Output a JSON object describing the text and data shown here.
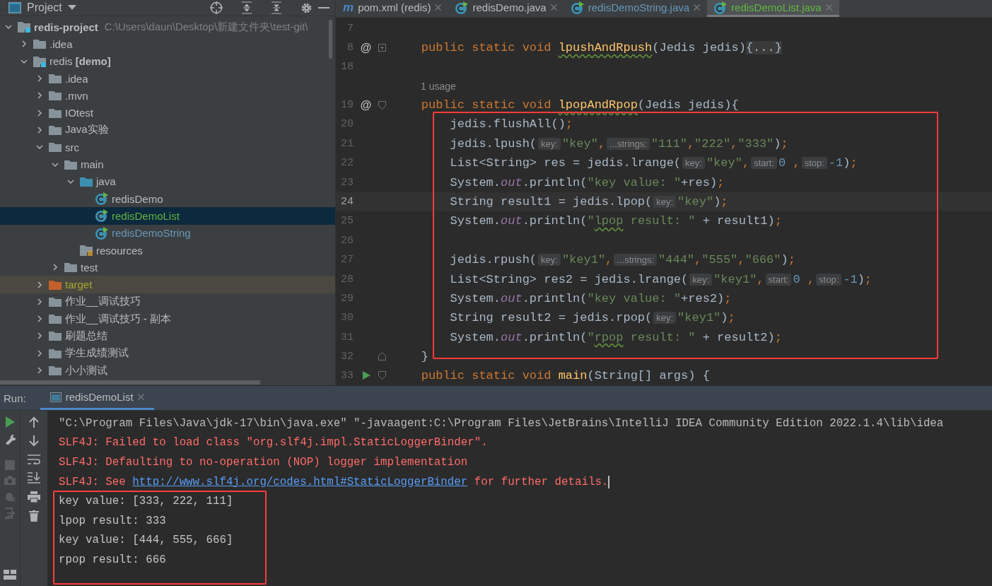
{
  "project_panel": {
    "title": "Project",
    "tree": [
      {
        "label": "redis-project",
        "kind": "module",
        "expanded": true,
        "selected": false,
        "path": "C:\\Users\\daun\\Desktop\\新建文件夹\\test-git\\",
        "children": [
          {
            "label": ".idea",
            "kind": "folder",
            "expanded": false,
            "selected": false
          },
          {
            "label": "redis **[demo]**",
            "kind": "module",
            "expanded": true,
            "selected": false,
            "children": [
              {
                "label": ".idea",
                "kind": "folder",
                "expanded": false,
                "selected": false
              },
              {
                "label": ".mvn",
                "kind": "folder",
                "expanded": false,
                "selected": false
              },
              {
                "label": "IOtest",
                "kind": "folder",
                "expanded": false,
                "selected": false
              },
              {
                "label": "Java实验",
                "kind": "folder",
                "expanded": false,
                "selected": false
              },
              {
                "label": "src",
                "kind": "folder",
                "expanded": true,
                "selected": false,
                "children": [
                  {
                    "label": "main",
                    "kind": "folder",
                    "expanded": true,
                    "selected": false,
                    "children": [
                      {
                        "label": "java",
                        "kind": "source-folder",
                        "expanded": true,
                        "selected": false,
                        "children": [
                          {
                            "label": "redisDemo",
                            "kind": "class",
                            "selected": false,
                            "color": "#bbbbbb"
                          },
                          {
                            "label": "redisDemoList",
                            "kind": "class",
                            "selected": true,
                            "color": "#62b543"
                          },
                          {
                            "label": "redisDemoString",
                            "kind": "class",
                            "selected": false,
                            "color": "#6897bb"
                          }
                        ]
                      },
                      {
                        "label": "resources",
                        "kind": "resources",
                        "selected": false
                      }
                    ]
                  },
                  {
                    "label": "test",
                    "kind": "folder",
                    "expanded": false,
                    "selected": false
                  }
                ]
              },
              {
                "label": "target",
                "kind": "excluded",
                "expanded": false,
                "selected": false
              },
              {
                "label": "作业__调试技巧",
                "kind": "folder",
                "expanded": false,
                "selected": false
              },
              {
                "label": "作业__调试技巧 - 副本",
                "kind": "folder",
                "expanded": false,
                "selected": false
              },
              {
                "label": "刷题总结",
                "kind": "folder",
                "expanded": false,
                "selected": false
              },
              {
                "label": "学生成绩测试",
                "kind": "folder",
                "expanded": false,
                "selected": false
              },
              {
                "label": "小小测试",
                "kind": "folder",
                "expanded": false,
                "selected": false
              }
            ]
          }
        ]
      }
    ]
  },
  "editor": {
    "tabs": [
      {
        "label": "pom.xml (redis)",
        "kind": "maven",
        "glyph": "m",
        "selected": false,
        "color": "#bbbbbb"
      },
      {
        "label": "redisDemo.java",
        "kind": "class",
        "selected": false,
        "color": "#bbbbbb"
      },
      {
        "label": "redisDemoString.java",
        "kind": "class",
        "selected": false,
        "color": "#6897bb"
      },
      {
        "label": "redisDemoList.java",
        "kind": "class",
        "selected": true,
        "color": "#62b543"
      }
    ],
    "lines": [
      {
        "number": "7",
        "current": false
      },
      {
        "number": "8",
        "gutter": {
          "kind": "override",
          "text": "@"
        },
        "fold": {
          "kind": "expand"
        },
        "current": false,
        "tokens": [
          {
            "kind": "kw",
            "text": "    public static void "
          },
          {
            "kind": "method",
            "text": "lpushAndRpush"
          },
          {
            "kind": "plain",
            "text": "(Jedis jedis)"
          },
          {
            "kind": "folded",
            "text": "{...}"
          }
        ]
      },
      {
        "number": "18",
        "current": false
      },
      {
        "kind": "usage",
        "text": "1 usage"
      },
      {
        "number": "19",
        "gutter": {
          "kind": "override",
          "text": "@"
        },
        "fold": {
          "kind": "start"
        },
        "current": false,
        "tokens": [
          {
            "kind": "kw",
            "text": "    public static void "
          },
          {
            "kind": "method",
            "text": "lpopAndRpop"
          },
          {
            "kind": "plain",
            "text": "(Jedis jedis){"
          }
        ]
      },
      {
        "kind": "boxed",
        "lines": [
          {
            "number": "20",
            "current": false,
            "tokens": [
              {
                "kind": "plain",
                "text": "        jedis.flushAll()"
              },
              {
                "kind": "punct",
                "text": ";"
              }
            ]
          },
          {
            "number": "21",
            "current": false,
            "tokens": [
              {
                "kind": "plain",
                "text": "        jedis.lpush("
              },
              {
                "kind": "hint",
                "text": "key:"
              },
              {
                "kind": "str",
                "text": "\"key\""
              },
              {
                "kind": "punct",
                "text": ","
              },
              {
                "kind": "hint",
                "text": "...strings:"
              },
              {
                "kind": "str",
                "text": "\"111\""
              },
              {
                "kind": "punct",
                "text": ","
              },
              {
                "kind": "str",
                "text": "\"222\""
              },
              {
                "kind": "punct",
                "text": ","
              },
              {
                "kind": "str",
                "text": "\"333\""
              },
              {
                "kind": "plain",
                "text": ")"
              },
              {
                "kind": "punct",
                "text": ";"
              }
            ]
          },
          {
            "number": "22",
            "current": false,
            "tokens": [
              {
                "kind": "plain",
                "text": "        List<String> res = jedis.lrange("
              },
              {
                "kind": "hint",
                "text": "key:"
              },
              {
                "kind": "str",
                "text": "\"key\""
              },
              {
                "kind": "punct",
                "text": ","
              },
              {
                "kind": "hint",
                "text": "start:"
              },
              {
                "kind": "num",
                "text": "0"
              },
              {
                "kind": "punct",
                "text": " ,"
              },
              {
                "kind": "hint",
                "text": "stop:"
              },
              {
                "kind": "num",
                "text": "-1"
              },
              {
                "kind": "plain",
                "text": ")"
              },
              {
                "kind": "punct",
                "text": ";"
              }
            ]
          },
          {
            "number": "23",
            "current": false,
            "tokens": [
              {
                "kind": "plain",
                "text": "        System."
              },
              {
                "kind": "field",
                "text": "out"
              },
              {
                "kind": "plain",
                "text": ".println("
              },
              {
                "kind": "str",
                "text": "\"key value: \""
              },
              {
                "kind": "plain",
                "text": "+res)"
              },
              {
                "kind": "punct",
                "text": ";"
              }
            ]
          },
          {
            "number": "24",
            "current": true,
            "tokens": [
              {
                "kind": "plain",
                "text": "        String result1 = jedis.lpop("
              },
              {
                "kind": "hint",
                "text": "key:"
              },
              {
                "kind": "str",
                "text": "\"key\""
              },
              {
                "kind": "plain",
                "text": ")"
              },
              {
                "kind": "punct",
                "text": ";"
              }
            ]
          },
          {
            "number": "25",
            "current": false,
            "tokens": [
              {
                "kind": "plain",
                "text": "        System."
              },
              {
                "kind": "field",
                "text": "out"
              },
              {
                "kind": "plain",
                "text": ".println("
              },
              {
                "kind": "str",
                "text": "\""
              },
              {
                "kind": "str-typo",
                "text": "lpop"
              },
              {
                "kind": "str",
                "text": " result: \""
              },
              {
                "kind": "plain",
                "text": " + result1)"
              },
              {
                "kind": "punct",
                "text": ";"
              }
            ]
          },
          {
            "number": "26",
            "current": false
          },
          {
            "number": "27",
            "current": false,
            "tokens": [
              {
                "kind": "plain",
                "text": "        jedis.rpush("
              },
              {
                "kind": "hint",
                "text": "key:"
              },
              {
                "kind": "str",
                "text": "\"key1\""
              },
              {
                "kind": "punct",
                "text": ","
              },
              {
                "kind": "hint",
                "text": "...strings:"
              },
              {
                "kind": "str",
                "text": "\"444\""
              },
              {
                "kind": "punct",
                "text": ","
              },
              {
                "kind": "str",
                "text": "\"555\""
              },
              {
                "kind": "punct",
                "text": ","
              },
              {
                "kind": "str",
                "text": "\"666\""
              },
              {
                "kind": "plain",
                "text": ")"
              },
              {
                "kind": "punct",
                "text": ";"
              }
            ]
          },
          {
            "number": "28",
            "current": false,
            "tokens": [
              {
                "kind": "plain",
                "text": "        List<String> res2 = jedis.lrange("
              },
              {
                "kind": "hint",
                "text": "key:"
              },
              {
                "kind": "str",
                "text": "\"key1\""
              },
              {
                "kind": "punct",
                "text": ","
              },
              {
                "kind": "hint",
                "text": "start:"
              },
              {
                "kind": "num",
                "text": "0"
              },
              {
                "kind": "punct",
                "text": " ,"
              },
              {
                "kind": "hint",
                "text": "stop:"
              },
              {
                "kind": "num",
                "text": "-1"
              },
              {
                "kind": "plain",
                "text": ")"
              },
              {
                "kind": "punct",
                "text": ";"
              }
            ]
          },
          {
            "number": "29",
            "current": false,
            "tokens": [
              {
                "kind": "plain",
                "text": "        System."
              },
              {
                "kind": "field",
                "text": "out"
              },
              {
                "kind": "plain",
                "text": ".println("
              },
              {
                "kind": "str",
                "text": "\"key value: \""
              },
              {
                "kind": "plain",
                "text": "+res2)"
              },
              {
                "kind": "punct",
                "text": ";"
              }
            ]
          },
          {
            "number": "30",
            "current": false,
            "tokens": [
              {
                "kind": "plain",
                "text": "        String result2 = jedis.rpop("
              },
              {
                "kind": "hint",
                "text": "key:"
              },
              {
                "kind": "str",
                "text": "\"key1\""
              },
              {
                "kind": "plain",
                "text": ")"
              },
              {
                "kind": "punct",
                "text": ";"
              }
            ]
          },
          {
            "number": "31",
            "current": false,
            "tokens": [
              {
                "kind": "plain",
                "text": "        System."
              },
              {
                "kind": "field",
                "text": "out"
              },
              {
                "kind": "plain",
                "text": ".println("
              },
              {
                "kind": "str",
                "text": "\""
              },
              {
                "kind": "str-typo",
                "text": "rpop"
              },
              {
                "kind": "str",
                "text": " result: \""
              },
              {
                "kind": "plain",
                "text": " + result2)"
              },
              {
                "kind": "punct",
                "text": ";"
              }
            ]
          }
        ]
      },
      {
        "number": "32",
        "fold": {
          "kind": "end"
        },
        "current": false,
        "tokens": [
          {
            "kind": "plain",
            "text": "    }"
          }
        ]
      },
      {
        "number": "33",
        "gutter": {
          "kind": "run"
        },
        "fold": {
          "kind": "start"
        },
        "current": false,
        "tokens": [
          {
            "kind": "kw",
            "text": "    public static void "
          },
          {
            "kind": "method-plain",
            "text": "main"
          },
          {
            "kind": "plain",
            "text": "(String[] args) {"
          }
        ]
      }
    ]
  },
  "run_panel": {
    "label": "Run:",
    "tab": {
      "label": "redisDemoList",
      "selected": true
    },
    "console": [
      {
        "kind": "command",
        "text": "\"C:\\Program Files\\Java\\jdk-17\\bin\\java.exe\" \"-javaagent:C:\\Program Files\\JetBrains\\IntelliJ IDEA Community Edition 2022.1.4\\lib\\idea"
      },
      {
        "kind": "error",
        "text": "SLF4J: Failed to load class \"org.slf4j.impl.StaticLoggerBinder\"."
      },
      {
        "kind": "error",
        "text": "SLF4J: Defaulting to no-operation (NOP) logger implementation"
      },
      {
        "kind": "error",
        "text": "SLF4J: See ",
        "link": "http://www.slf4j.org/codes.html#StaticLoggerBinder",
        "after": " for further details."
      },
      {
        "kind": "boxed",
        "lines": [
          {
            "kind": "output",
            "text": "key value: [333, 222, 111]"
          },
          {
            "kind": "output",
            "text": "lpop result: 333"
          },
          {
            "kind": "output",
            "text": "key value: [444, 555, 666]"
          },
          {
            "kind": "output",
            "text": "rpop result: 666"
          }
        ]
      }
    ]
  }
}
